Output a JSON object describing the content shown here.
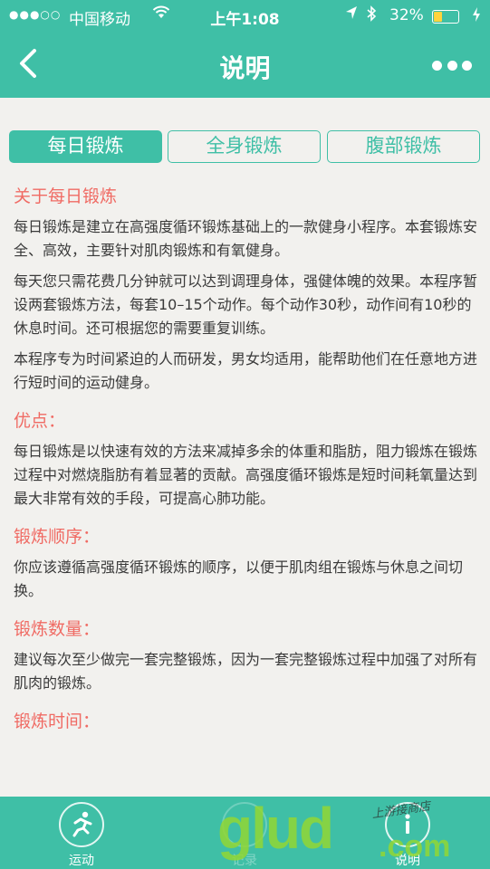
{
  "status_bar": {
    "signal": "●●●○○",
    "carrier": "中国移动",
    "time": "上午1:08",
    "battery_percent": "32%",
    "battery_level": 0.32
  },
  "nav": {
    "title": "说明"
  },
  "tabs": [
    {
      "label": "每日锻炼",
      "active": true
    },
    {
      "label": "全身锻炼",
      "active": false
    },
    {
      "label": "腹部锻炼",
      "active": false
    }
  ],
  "article": {
    "about_heading": "关于每日锻炼",
    "about_p1": "每日锻炼是建立在高强度循环锻炼基础上的一款健身小程序。本套锻炼安全、高效，主要针对肌肉锻炼和有氧健身。",
    "about_p2": "每天您只需花费几分钟就可以达到调理身体，强健体魄的效果。本程序暂设两套锻炼方法，每套10–15个动作。每个动作30秒，动作间有10秒的休息时间。还可根据您的需要重复训练。",
    "about_p3": "本程序专为时间紧迫的人而研发，男女均适用，能帮助他们在任意地方进行短时间的运动健身。",
    "advantage_heading": "优点：",
    "advantage_p": "每日锻炼是以快速有效的方法来减掉多余的体重和脂肪，阻力锻炼在锻炼过程中对燃烧脂肪有着显著的贡献。高强度循环锻炼是短时间耗氧量达到最大非常有效的手段，可提高心肺功能。",
    "order_heading": "锻炼顺序：",
    "order_p": "你应该遵循高强度循环锻炼的顺序，以便于肌肉组在锻炼与休息之间切换。",
    "count_heading": "锻炼数量：",
    "count_p": "建议每次至少做完一套完整锻炼，因为一套完整锻炼过程中加强了对所有肌肉的锻炼。",
    "time_heading": "锻炼时间："
  },
  "tabbar": {
    "items": [
      {
        "label": "运动",
        "icon": "runner-icon"
      },
      {
        "label": "记录",
        "icon": "record-icon"
      },
      {
        "label": "说明",
        "icon": "info-icon"
      }
    ]
  },
  "watermark": {
    "big": "glud",
    "small": "上游接商店",
    "dot": ".com"
  },
  "colors": {
    "brand": "#3fbfa6",
    "heading": "#f06b64",
    "battery": "#ffd33d"
  }
}
